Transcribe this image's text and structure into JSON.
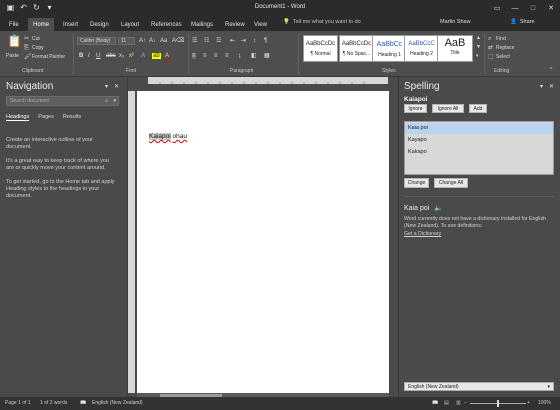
{
  "titlebar": {
    "doc_title": "Document1 - Word"
  },
  "tabs": [
    {
      "label": "File"
    },
    {
      "label": "Home"
    },
    {
      "label": "Insert"
    },
    {
      "label": "Design"
    },
    {
      "label": "Layout"
    },
    {
      "label": "References"
    },
    {
      "label": "Mailings"
    },
    {
      "label": "Review"
    },
    {
      "label": "View"
    }
  ],
  "tellme": {
    "placeholder": "Tell me what you want to do"
  },
  "user": {
    "name": "Martin Shaw"
  },
  "share": {
    "label": "Share"
  },
  "ribbon": {
    "clipboard": {
      "paste": "Paste",
      "cut": "Cut",
      "copy": "Copy",
      "format_painter": "Format Painter",
      "group": "Clipboard"
    },
    "font": {
      "name": "Calibri (Body)",
      "size": "11",
      "group": "Font"
    },
    "paragraph": {
      "group": "Paragraph"
    },
    "styles": {
      "group": "Styles",
      "items": [
        {
          "sample": "AaBbCcDc",
          "name": "¶ Normal"
        },
        {
          "sample": "AaBbCcDc",
          "name": "¶ No Spac..."
        },
        {
          "sample": "AaBbCc",
          "name": "Heading 1"
        },
        {
          "sample": "AaBbCcC",
          "name": "Heading 2"
        },
        {
          "sample": "AaB",
          "name": "Title"
        }
      ]
    },
    "editing": {
      "find": "Find",
      "replace": "Replace",
      "select": "Select",
      "group": "Editing"
    }
  },
  "navigation": {
    "title": "Navigation",
    "search_placeholder": "Search document",
    "tabs": [
      "Headings",
      "Pages",
      "Results"
    ],
    "body": [
      "Create an interactive outline of your document.",
      "It's a great way to keep track of where you are or quickly move your content around.",
      "To get started, go to the Home tab and apply Heading styles to the headings in your document."
    ]
  },
  "document": {
    "word1": "Kaiapoi",
    "word2": "ohau"
  },
  "spelling": {
    "title": "Spelling",
    "word": "Kaiapoi",
    "ignore": "Ignore",
    "ignore_all": "Ignore All",
    "add": "Add",
    "suggestions": [
      "Kaia poi",
      "Kayapo",
      "Kakapo"
    ],
    "change": "Change",
    "change_all": "Change All",
    "def_word": "Kaia poi",
    "def_text": "Word currently does not have a dictionary installed for English (New Zealand). To see definitions:",
    "def_link": "Get a Dictionary",
    "language": "English (New Zealand)"
  },
  "status": {
    "page": "Page 1 of 1",
    "words": "1 of 2 words",
    "language": "English (New Zealand)",
    "zoom": "100%"
  }
}
